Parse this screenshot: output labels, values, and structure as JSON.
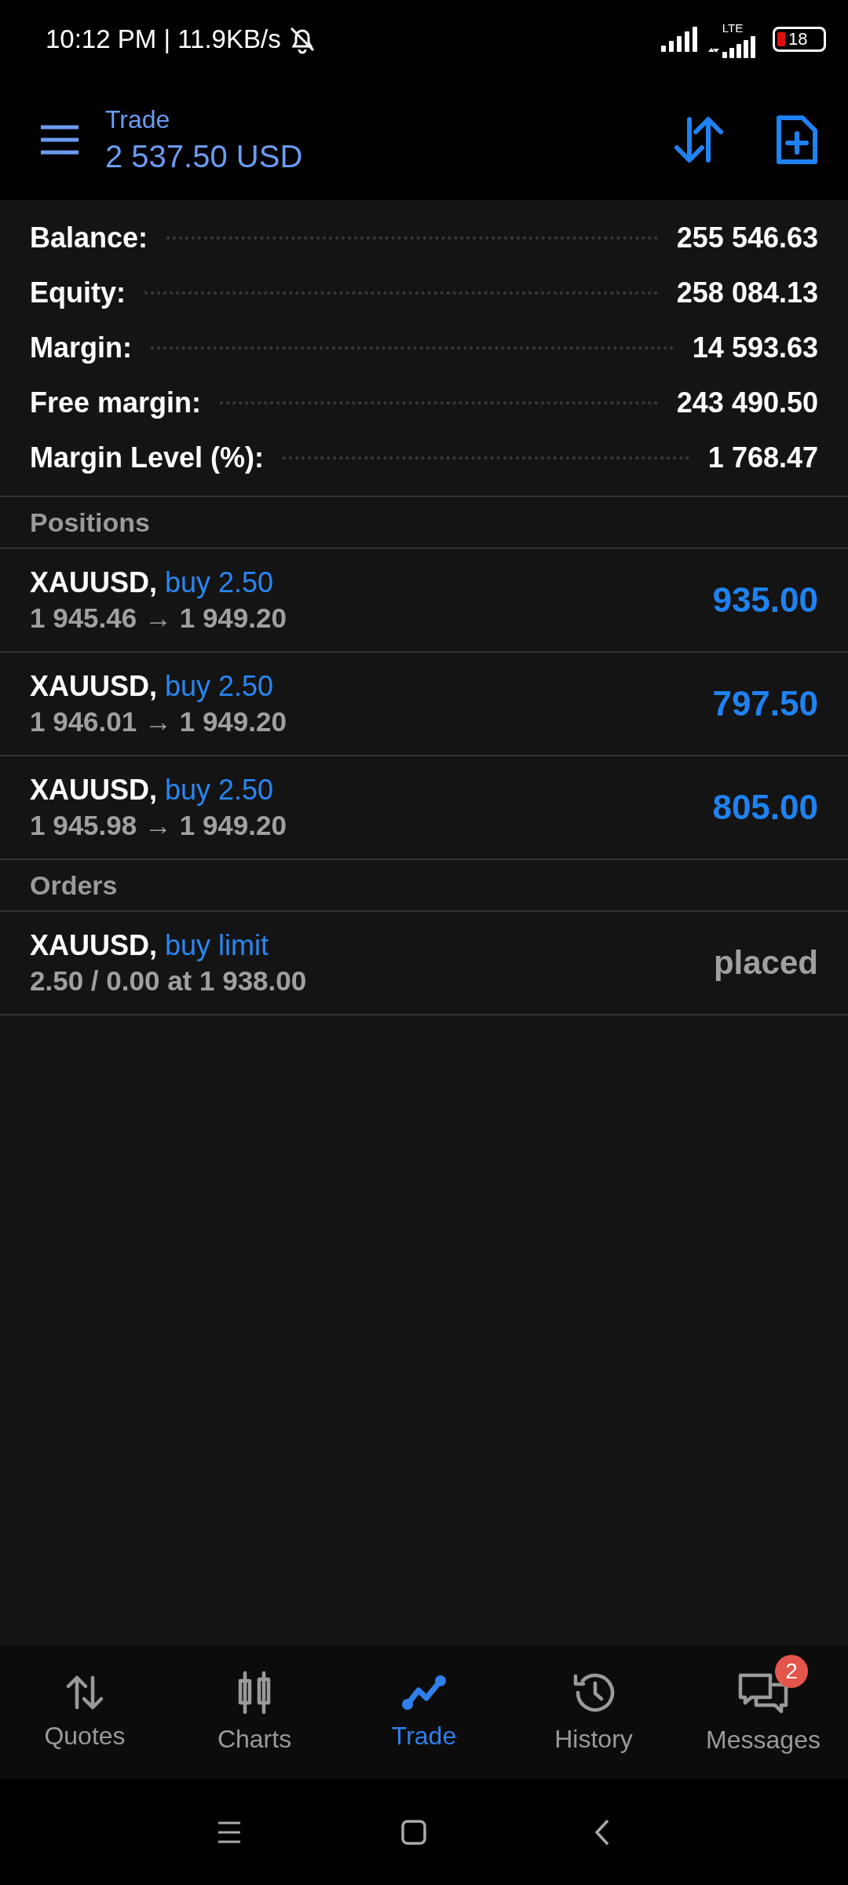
{
  "status_bar": {
    "time_speed": "10:12 PM | 11.9KB/s",
    "network": "LTE",
    "battery": "18"
  },
  "header": {
    "title": "Trade",
    "balance": "2 537.50 USD"
  },
  "summary": [
    {
      "label": "Balance:",
      "value": "255 546.63"
    },
    {
      "label": "Equity:",
      "value": "258 084.13"
    },
    {
      "label": "Margin:",
      "value": "14 593.63"
    },
    {
      "label": "Free margin:",
      "value": "243 490.50"
    },
    {
      "label": "Margin Level (%):",
      "value": "1 768.47"
    }
  ],
  "positions": {
    "title": "Positions",
    "items": [
      {
        "symbol": "XAUUSD,",
        "side": "buy 2.50",
        "prices": "1 945.46 → 1 949.20",
        "profit": "935.00"
      },
      {
        "symbol": "XAUUSD,",
        "side": "buy 2.50",
        "prices": "1 946.01 → 1 949.20",
        "profit": "797.50"
      },
      {
        "symbol": "XAUUSD,",
        "side": "buy 2.50",
        "prices": "1 945.98 → 1 949.20",
        "profit": "805.00"
      }
    ]
  },
  "orders": {
    "title": "Orders",
    "items": [
      {
        "symbol": "XAUUSD,",
        "side": "buy limit",
        "details": "2.50 / 0.00 at 1 938.00",
        "status": "placed"
      }
    ]
  },
  "tabs": [
    {
      "kind": "quotes",
      "label": "Quotes",
      "selected": false
    },
    {
      "kind": "charts",
      "label": "Charts",
      "selected": false
    },
    {
      "kind": "trade",
      "label": "Trade",
      "selected": true
    },
    {
      "kind": "history",
      "label": "History",
      "selected": false
    },
    {
      "kind": "messages",
      "label": "Messages",
      "selected": false,
      "badge": "2"
    }
  ]
}
